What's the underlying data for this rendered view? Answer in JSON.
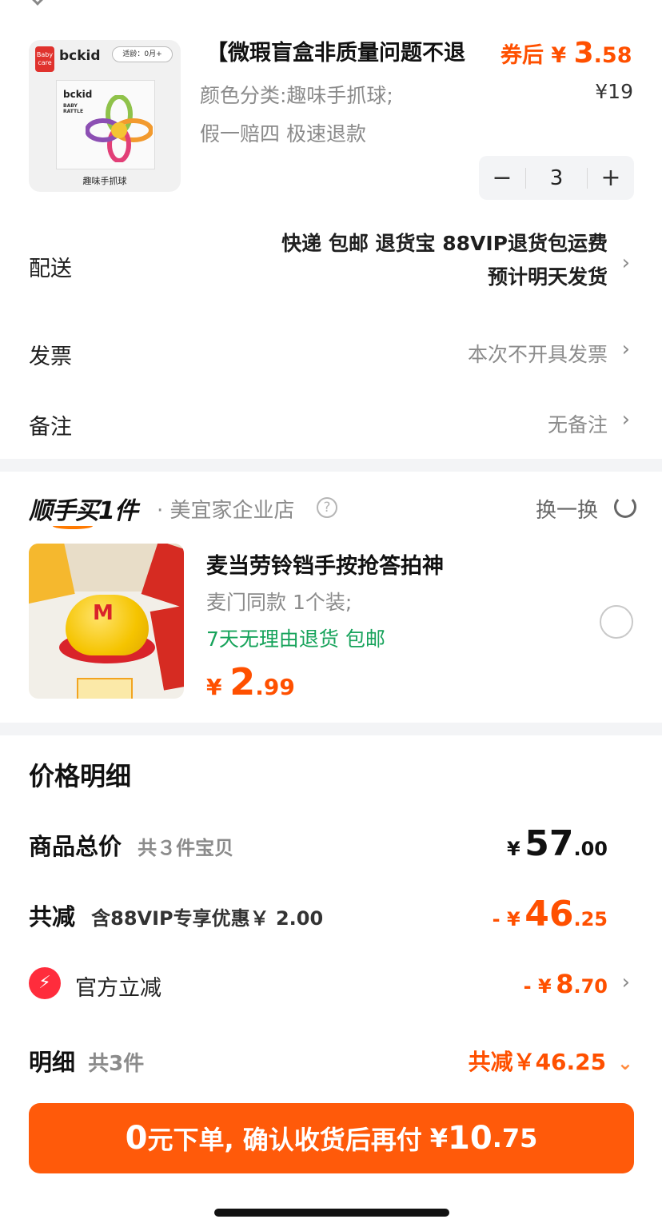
{
  "product": {
    "title": "【微瑕盲盒非质量问题不退",
    "after_coupon_label": "券后",
    "after_coupon_yen": "¥",
    "after_coupon_int": "3",
    "after_coupon_dec": ".58",
    "spec": "颜色分类:趣味手抓球;",
    "original_price": "¥19",
    "tags": "假一赔四  极速退款",
    "quantity": "3",
    "image": {
      "brand_logo": "bckid",
      "brand_badge": "Baby care",
      "age_tag": "适龄：0月+",
      "box_brand": "bckid",
      "box_subtitle": "BABY RATTLE",
      "caption": "趣味手抓球"
    }
  },
  "delivery": {
    "label": "配送",
    "line1": "快递 包邮 退货宝 88VIP退货包运费",
    "line2": "预计明天发货"
  },
  "invoice": {
    "label": "发票",
    "value": "本次不开具发票"
  },
  "note": {
    "label": "备注",
    "value": "无备注"
  },
  "buy_together": {
    "title": "顺手买1件",
    "store": "· 美宜家企业店",
    "swap_label": "换一换",
    "item": {
      "name": "麦当劳铃铛手按抢答拍神",
      "spec": "麦门同款 1个装;",
      "promo": "7天无理由退货  包邮",
      "price_yen": "¥",
      "price_int": "2",
      "price_dec": ".99"
    }
  },
  "price_detail": {
    "title": "价格明细",
    "goods_total": {
      "label": "商品总价",
      "sub": "共３件宝贝",
      "yen": "¥",
      "int": "57",
      "dec": ".00"
    },
    "discount": {
      "label": "共减",
      "sub": "含88VIP专享优惠￥ 2.00",
      "prefix": "- ¥",
      "int": "46",
      "dec": ".25"
    },
    "official": {
      "label": "官方立减",
      "prefix": "- ¥",
      "int": "8",
      "dec": ".70"
    },
    "summary": {
      "label": "明细",
      "sub": "共3件",
      "total_label": "共减￥46.25"
    }
  },
  "cta": {
    "zero": "0",
    "text": "元下单, 确认收货后再付",
    "yen": "¥",
    "int": "10",
    "dec": ".75"
  },
  "colors": {
    "accent": "#ff5000",
    "cta": "#ff5a0a",
    "green": "#17a35b",
    "bolt": "#ff2c3c"
  }
}
